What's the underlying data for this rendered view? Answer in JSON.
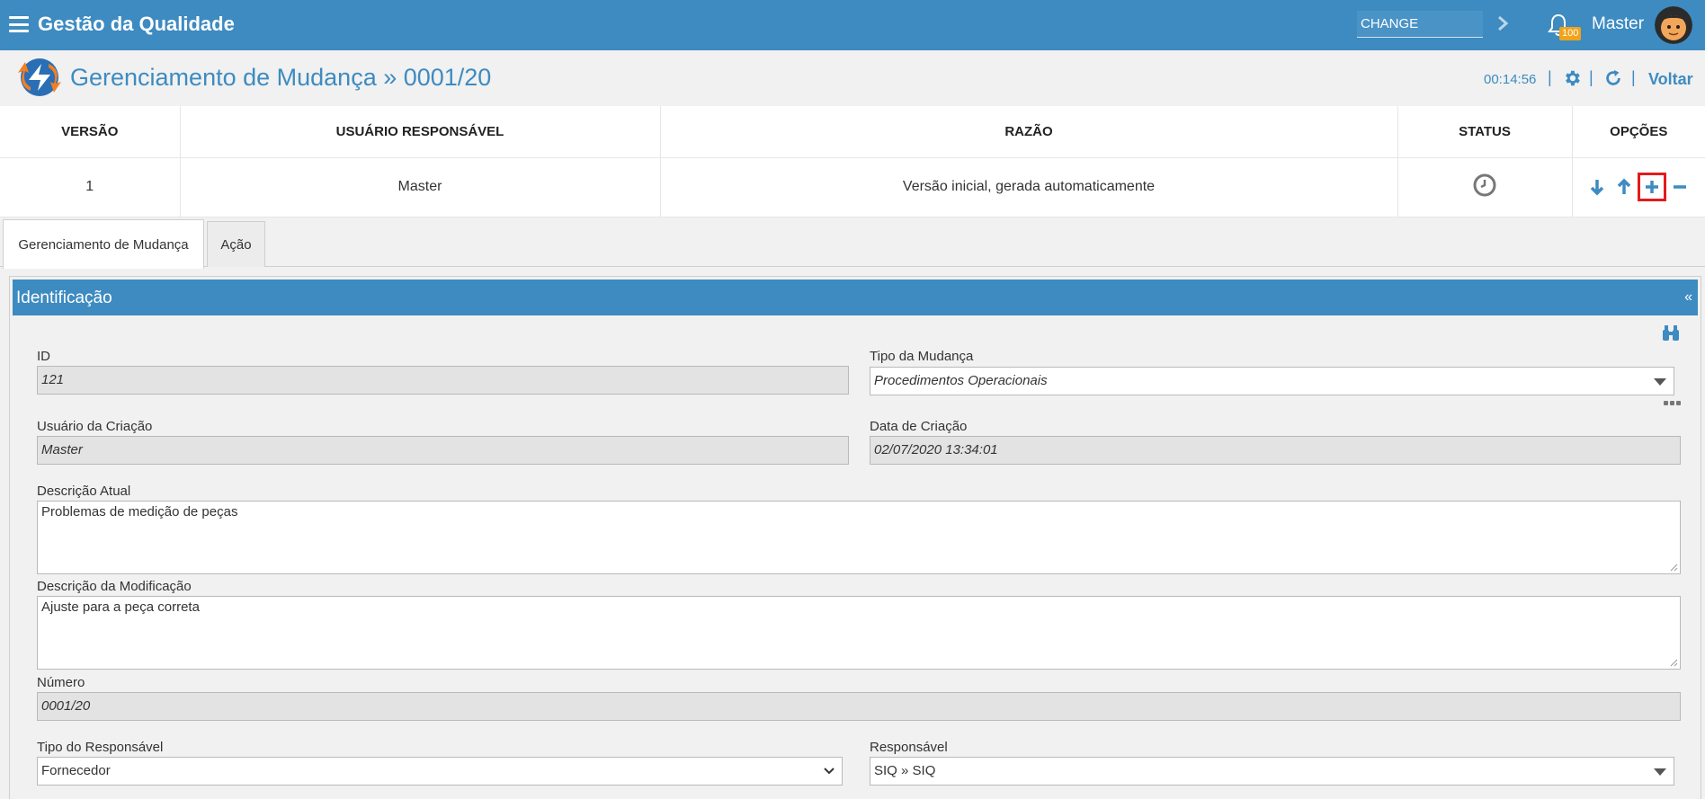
{
  "header": {
    "app_title": "Gestão da Qualidade",
    "search_value": "CHANGE",
    "notification_count": "100",
    "user_name": "Master"
  },
  "subheader": {
    "page_title": "Gerenciamento de Mudança » 0001/20",
    "timer": "00:14:56",
    "back_label": "Voltar",
    "separator": "|"
  },
  "versions": {
    "columns": [
      "VERSÃO",
      "USUÁRIO RESPONSÁVEL",
      "RAZÃO",
      "STATUS",
      "OPÇÕES"
    ],
    "rows": [
      {
        "version": "1",
        "user": "Master",
        "reason": "Versão inicial, gerada automaticamente"
      }
    ]
  },
  "tabs": [
    {
      "label": "Gerenciamento de Mudança",
      "active": true
    },
    {
      "label": "Ação",
      "active": false
    }
  ],
  "panel": {
    "title": "Identificação",
    "collapse_symbol": "«",
    "fields": {
      "id": {
        "label": "ID",
        "value": "121"
      },
      "tipo_mudanca": {
        "label": "Tipo da Mudança",
        "value": "Procedimentos Operacionais"
      },
      "usuario_criacao": {
        "label": "Usuário da Criação",
        "value": "Master"
      },
      "data_criacao": {
        "label": "Data de Criação",
        "value": "02/07/2020 13:34:01"
      },
      "descricao_atual": {
        "label": "Descrição Atual",
        "value": "Problemas de medição de peças"
      },
      "descricao_modificacao": {
        "label": "Descrição da Modificação",
        "value": "Ajuste para a peça correta"
      },
      "numero": {
        "label": "Número",
        "value": "0001/20"
      },
      "tipo_responsavel": {
        "label": "Tipo do Responsável",
        "value": "Fornecedor"
      },
      "responsavel": {
        "label": "Responsável",
        "value": "SIQ  »  SIQ"
      }
    }
  },
  "colors": {
    "primary": "#3d8bc1",
    "badge": "#f1a31b",
    "highlight": "#e41b1b",
    "logo_orange": "#f57f20",
    "logo_blue": "#2a6fb5"
  }
}
